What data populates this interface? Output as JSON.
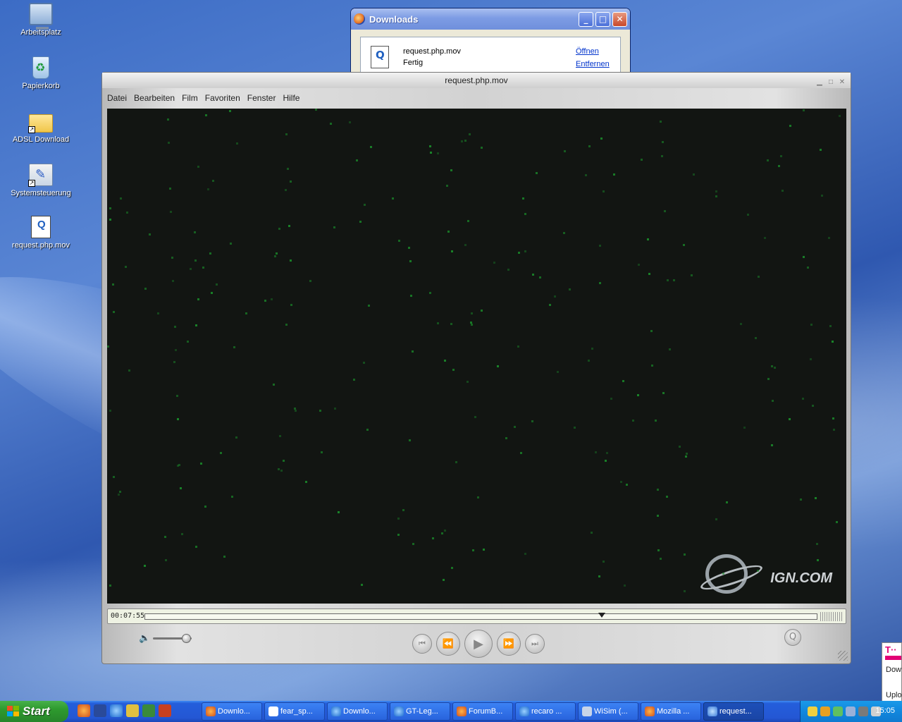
{
  "desktop": {
    "icons": [
      {
        "label": "Arbeitsplatz",
        "icon": "my-computer-icon"
      },
      {
        "label": "Papierkorb",
        "icon": "recycle-bin-icon"
      },
      {
        "label": "ADSL Download",
        "icon": "folder-shortcut-icon"
      },
      {
        "label": "Systemsteuerung",
        "icon": "control-panel-shortcut-icon"
      },
      {
        "label": "request.php.mov",
        "icon": "quicktime-movie-icon"
      }
    ]
  },
  "downloads_window": {
    "title": "Downloads",
    "item": {
      "filename": "request.php.mov",
      "status": "Fertig",
      "open_label": "Öffnen",
      "remove_label": "Entfernen"
    }
  },
  "player": {
    "title": "request.php.mov",
    "menu": [
      "Datei",
      "Bearbeiten",
      "Film",
      "Favoriten",
      "Fenster",
      "Hilfe"
    ],
    "watermark": "IGN.COM",
    "timecode": "00:07:55",
    "progress": 0.68,
    "volume": 0.85
  },
  "widget": {
    "logo": "T··",
    "download_label": "Dow",
    "upload_label": "Uplo",
    "brand_color": "#e20074"
  },
  "taskbar": {
    "start_label": "Start",
    "tasks": [
      {
        "label": "Downlo...",
        "icon": "firefox-icon"
      },
      {
        "label": "fear_sp...",
        "icon": "document-icon"
      },
      {
        "label": "Downlo...",
        "icon": "ie-icon"
      },
      {
        "label": "GT-Leg...",
        "icon": "ie-icon"
      },
      {
        "label": "ForumB...",
        "icon": "firefox-icon"
      },
      {
        "label": "recaro ...",
        "icon": "ie-icon"
      },
      {
        "label": "WiSim (...",
        "icon": "app-icon"
      },
      {
        "label": "Mozilla ...",
        "icon": "firefox-icon"
      },
      {
        "label": "request...",
        "icon": "quicktime-icon",
        "active": true
      }
    ],
    "clock": "15:05"
  }
}
